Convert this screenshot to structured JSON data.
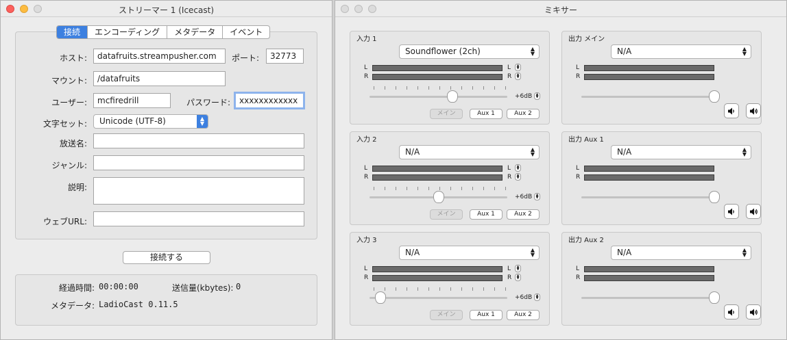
{
  "streamer": {
    "title": "ストリーマー 1 (Icecast)",
    "tabs": [
      "接続",
      "エンコーディング",
      "メタデータ",
      "イベント"
    ],
    "host_label": "ホスト:",
    "host_value": "datafruits.streampusher.com",
    "port_label": "ポート:",
    "port_value": "32773",
    "mount_label": "マウント:",
    "mount_value": "/datafruits",
    "user_label": "ユーザー:",
    "user_value": "mcfiredrill",
    "password_label": "パスワード:",
    "password_value": "xxxxxxxxxxxx",
    "charset_label": "文字セット:",
    "charset_value": "Unicode (UTF-8)",
    "name_label": "放送名:",
    "genre_label": "ジャンル:",
    "description_label": "説明:",
    "url_label": "ウェブURL:",
    "connect_button": "接続する",
    "elapsed_label": "経過時間:",
    "elapsed_value": "00:00:00",
    "sent_label": "送信量(kbytes):",
    "sent_value": "0",
    "meta_label": "メタデータ:",
    "meta_value": "LadioCast 0.11.5"
  },
  "mixer": {
    "title": "ミキサー",
    "inputs": [
      {
        "title": "入力 1",
        "device": "Soundflower (2ch)",
        "gain": "+6dB",
        "level": 0.6
      },
      {
        "title": "入力 2",
        "device": "N/A",
        "gain": "+6dB",
        "level": 0.5
      },
      {
        "title": "入力 3",
        "device": "N/A",
        "gain": "+6dB",
        "level": 0.08
      }
    ],
    "outputs": [
      {
        "title": "出力 メイン",
        "device": "N/A",
        "level": 1.0
      },
      {
        "title": "出力 Aux 1",
        "device": "N/A",
        "level": 1.0
      },
      {
        "title": "出力 Aux 2",
        "device": "N/A",
        "level": 1.0
      }
    ],
    "channel_l": "L",
    "channel_r": "R",
    "route_main": "メイン",
    "route_aux1": "Aux 1",
    "route_aux2": "Aux 2"
  }
}
